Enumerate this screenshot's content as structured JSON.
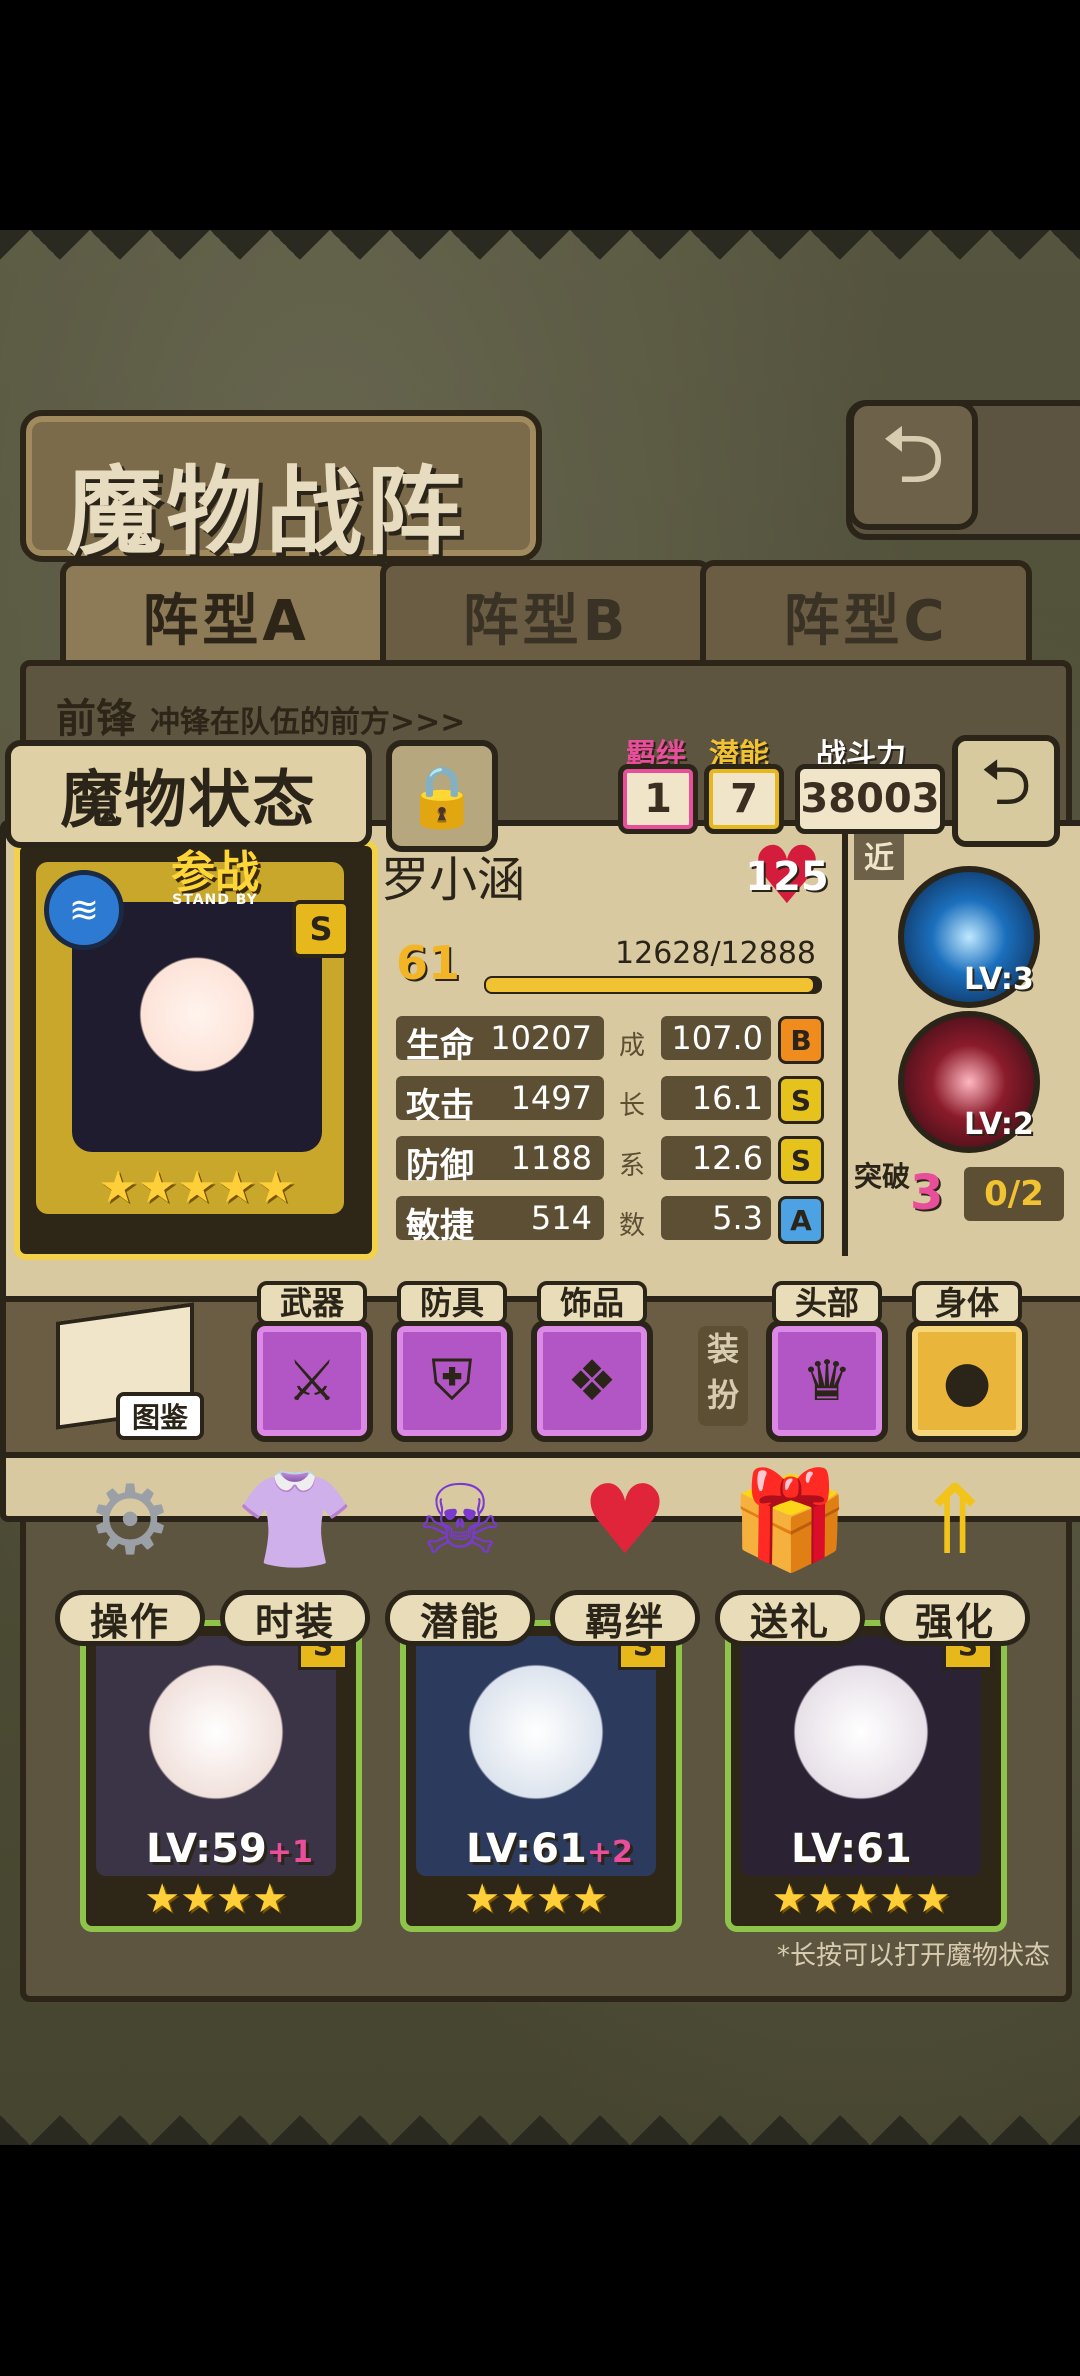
{
  "screen": {
    "title": "魔物战阵",
    "back_icon": "back-arrow-icon",
    "tabs": [
      "阵型A",
      "阵型B",
      "阵型C"
    ],
    "front_label": "前锋",
    "front_desc": "冲锋在队伍的前方>>>",
    "hint": "*长按可以打开魔物状态"
  },
  "status": {
    "title": "魔物状态",
    "lock_icon": "lock-icon",
    "bond_label": "羁绊",
    "bond_value": "1",
    "potential_label": "潜能",
    "potential_value": "7",
    "power_label": "战斗力",
    "power_value": "38003",
    "standby": "参战",
    "standby_en": "STAND BY",
    "rarity": "S",
    "name": "罗小涵",
    "heart_value": "125",
    "level": "61",
    "hp_text": "12628/12888",
    "hp_fraction": 0.98,
    "card_stars": "★★★★★",
    "growth_label": [
      "成",
      "长",
      "系",
      "数"
    ],
    "stats": [
      {
        "label": "生命",
        "value": "10207",
        "growth": "107.0",
        "rank": "B"
      },
      {
        "label": "攻击",
        "value": "1497",
        "growth": "16.1",
        "rank": "S"
      },
      {
        "label": "防御",
        "value": "1188",
        "growth": "12.6",
        "rank": "S"
      },
      {
        "label": "敏捷",
        "value": "514",
        "growth": "5.3",
        "rank": "A"
      }
    ],
    "range_label": "近",
    "skills": [
      {
        "level": "LV:3",
        "color": "#1b6fbd"
      },
      {
        "level": "LV:2",
        "color": "#8b1b2b"
      }
    ],
    "break_label": "突破",
    "break_value": "3",
    "break_progress": "0/2"
  },
  "equipment": {
    "book_label": "图鉴",
    "slots": [
      {
        "label": "武器",
        "icon": "sword-icon"
      },
      {
        "label": "防具",
        "icon": "shield-icon"
      },
      {
        "label": "饰品",
        "icon": "accessory-icon"
      },
      {
        "label": "头部",
        "icon": "crown-icon"
      },
      {
        "label": "身体",
        "icon": "pumpkin-icon"
      }
    ],
    "dress_label": "装扮"
  },
  "actions": [
    {
      "label": "操作",
      "icon": "gear-icon"
    },
    {
      "label": "时装",
      "icon": "outfit-icon"
    },
    {
      "label": "潜能",
      "icon": "demon-icon"
    },
    {
      "label": "羁绊",
      "icon": "hearts-icon"
    },
    {
      "label": "送礼",
      "icon": "gift-icon"
    },
    {
      "label": "强化",
      "icon": "upgrade-arrows-icon"
    }
  ],
  "team": [
    {
      "level": "LV:59",
      "plus": "+1",
      "stars": "★★★★",
      "rarity": "S"
    },
    {
      "level": "LV:61",
      "plus": "+2",
      "stars": "★★★★",
      "rarity": "S"
    },
    {
      "level": "LV:61",
      "plus": "",
      "stars": "★★★★★",
      "rarity": "S"
    }
  ]
}
